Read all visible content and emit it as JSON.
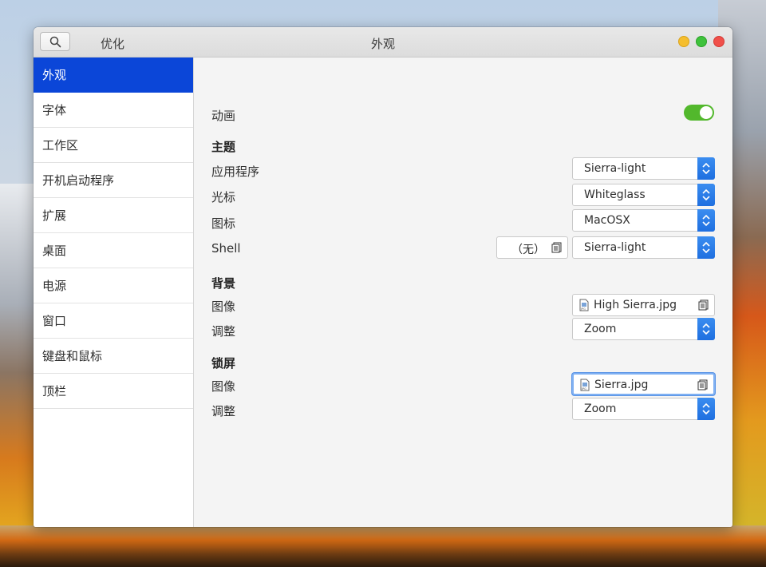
{
  "window": {
    "app_title": "优化",
    "page_title": "外观"
  },
  "sidebar": {
    "items": [
      {
        "label": "外观",
        "active": true
      },
      {
        "label": "字体"
      },
      {
        "label": "工作区"
      },
      {
        "label": "开机启动程序"
      },
      {
        "label": "扩展"
      },
      {
        "label": "桌面"
      },
      {
        "label": "电源"
      },
      {
        "label": "窗口"
      },
      {
        "label": "键盘和鼠标"
      },
      {
        "label": "顶栏"
      }
    ]
  },
  "appearance": {
    "animation_label": "动画",
    "animation_on": true,
    "theme": {
      "heading": "主题",
      "applications_label": "应用程序",
      "applications_value": "Sierra-light",
      "cursor_label": "光标",
      "cursor_value": "Whiteglass",
      "icons_label": "图标",
      "icons_value": "MacOSX",
      "shell_label": "Shell",
      "shell_file": "（无）",
      "shell_value": "Sierra-light"
    },
    "background": {
      "heading": "背景",
      "image_label": "图像",
      "image_file": "High Sierra.jpg",
      "adjust_label": "调整",
      "adjust_value": "Zoom"
    },
    "lock_screen": {
      "heading": "锁屏",
      "image_label": "图像",
      "image_file": "Sierra.jpg",
      "adjust_label": "调整",
      "adjust_value": "Zoom"
    }
  },
  "colors": {
    "accent": "#0b46d8",
    "toggle_on": "#52b82c",
    "combo_arrow": "#1f6fe0"
  }
}
